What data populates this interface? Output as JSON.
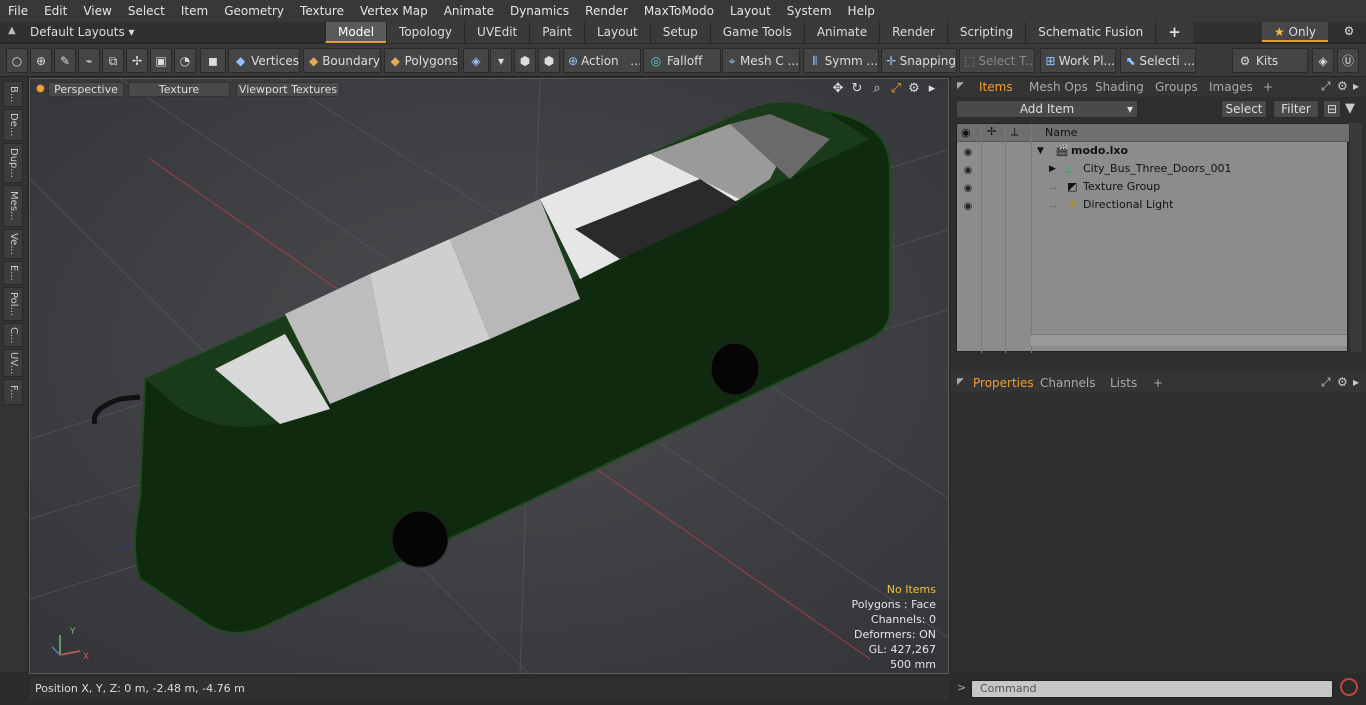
{
  "menubar": {
    "items": [
      "File",
      "Edit",
      "View",
      "Select",
      "Item",
      "Geometry",
      "Texture",
      "Vertex Map",
      "Animate",
      "Dynamics",
      "Render",
      "MaxToModo",
      "Layout",
      "System",
      "Help"
    ]
  },
  "layoutbar": {
    "layout_selector": "Default Layouts",
    "tabs": [
      "Model",
      "Topology",
      "UVEdit",
      "Paint",
      "Layout",
      "Setup",
      "Game Tools",
      "Animate",
      "Render",
      "Scripting",
      "Schematic Fusion"
    ],
    "active_tab": "Model",
    "only_label": "Only"
  },
  "toolbar": {
    "vertices": "Vertices",
    "boundary": "Boundary",
    "polygons": "Polygons",
    "action": "Action",
    "falloff": "Falloff",
    "mesh": "Mesh C ...",
    "symmetry": "Symm ...",
    "snapping": "Snapping",
    "select_t": "Select T...",
    "work_plane": "Work Pl...",
    "selection": "Selecti ...",
    "kits": "Kits"
  },
  "left_tabs": [
    "B...",
    "De...",
    "Dup...",
    "Mes...",
    "Ve...",
    "E...",
    "Pol...",
    "C...",
    "UV...",
    "F..."
  ],
  "viewport": {
    "view_mode": "Perspective",
    "shading": "Texture",
    "textures": "Viewport Textures",
    "hud": {
      "selection": "No Items",
      "polygons": "Polygons : Face",
      "channels": "Channels: 0",
      "deformers": "Deformers: ON",
      "gl": "GL: 427,267",
      "scale": "500 mm"
    },
    "axis_y": "Y",
    "axis_x": "X"
  },
  "status": {
    "position": "Position X, Y, Z:   0 m, -2.48 m, -4.76 m"
  },
  "items_panel": {
    "tabs": [
      "Items",
      "Mesh Ops",
      "Shading",
      "Groups",
      "Images"
    ],
    "active_tab": "Items",
    "add_item": "Add Item",
    "select": "Select",
    "filter": "Filter",
    "column_name": "Name",
    "rows": [
      {
        "name": "modo.lxo",
        "icon": "scene-icon"
      },
      {
        "name": "City_Bus_Three_Doors_001",
        "icon": "mesh-locator-icon"
      },
      {
        "name": "Texture Group",
        "icon": "texture-group-icon"
      },
      {
        "name": "Directional Light",
        "icon": "light-icon"
      }
    ]
  },
  "properties_panel": {
    "tabs": [
      "Properties",
      "Channels",
      "Lists"
    ],
    "active_tab": "Properties"
  },
  "command": {
    "placeholder": "Command"
  },
  "colors": {
    "accent": "#f0a030",
    "bus_body": "#0f2a0f",
    "viewport_bg": "#3d3e40"
  }
}
